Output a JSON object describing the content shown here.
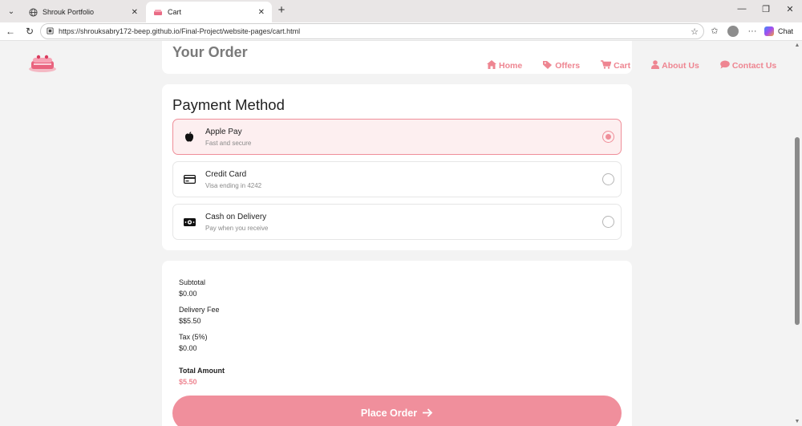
{
  "browser": {
    "tabs": [
      {
        "title": "Shrouk Portfolio",
        "icon": "globe-icon",
        "active": false
      },
      {
        "title": "Cart",
        "icon": "cake-favicon",
        "active": true
      }
    ],
    "url": "https://shrouksabry172-beep.github.io/Final-Project/website-pages/cart.html",
    "chat_label": "Chat"
  },
  "nav": {
    "items": [
      {
        "label": "Home",
        "icon": "home-icon"
      },
      {
        "label": "Offers",
        "icon": "tag-icon"
      },
      {
        "label": "Cart",
        "icon": "cart-icon"
      },
      {
        "label": "About Us",
        "icon": "user-icon"
      },
      {
        "label": "Contact Us",
        "icon": "comment-icon"
      }
    ]
  },
  "order": {
    "title": "Your Order"
  },
  "payment": {
    "title": "Payment Method",
    "options": [
      {
        "name": "Apple Pay",
        "description": "Fast and secure",
        "icon": "apple-icon",
        "selected": true
      },
      {
        "name": "Credit Card",
        "description": "Visa ending in 4242",
        "icon": "credit-card-icon",
        "selected": false
      },
      {
        "name": "Cash on Delivery",
        "description": "Pay when you receive",
        "icon": "cash-icon",
        "selected": false
      }
    ]
  },
  "summary": {
    "subtotal_label": "Subtotal",
    "subtotal_value": "$0.00",
    "delivery_label": "Delivery Fee",
    "delivery_value": "$$5.50",
    "tax_label": "Tax (5%)",
    "tax_value": "$0.00",
    "total_label": "Total Amount",
    "total_value": "$5.50"
  },
  "place_order_label": "Place Order",
  "colors": {
    "accent": "#ee8591",
    "button": "#f08f9c",
    "selected_bg": "#fdeff0"
  }
}
